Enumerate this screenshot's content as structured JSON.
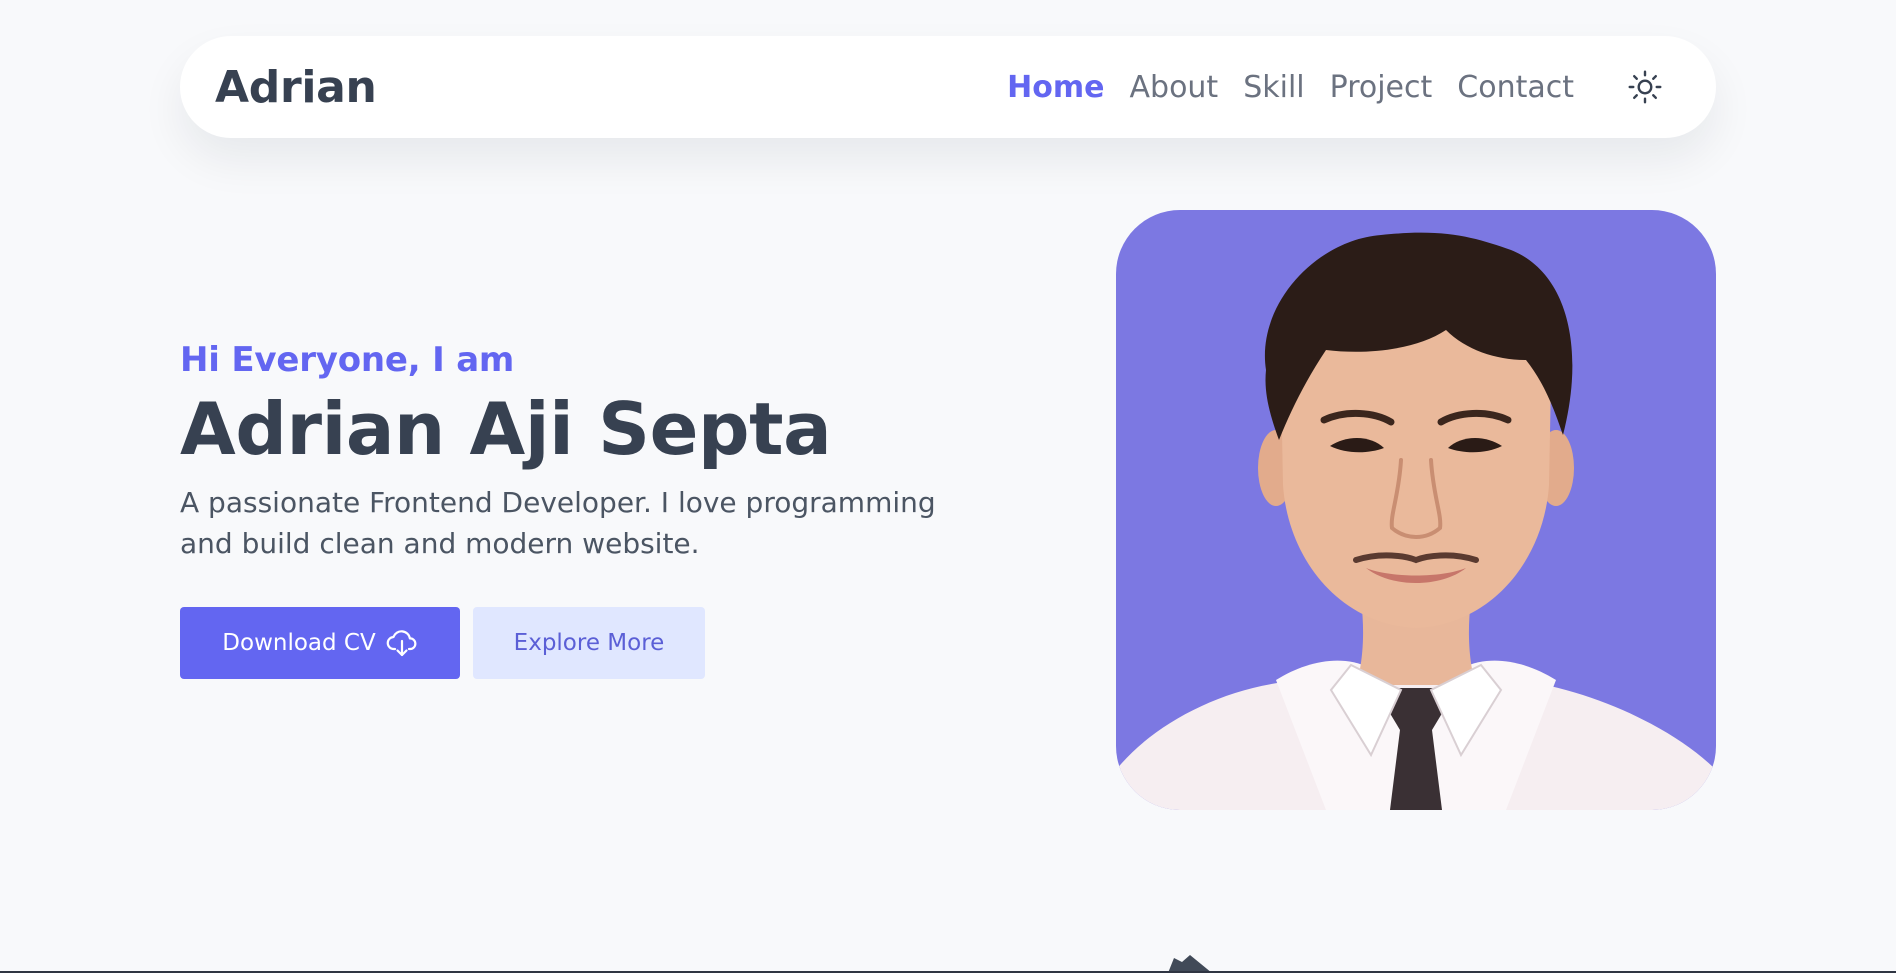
{
  "nav": {
    "brand": "Adrian",
    "links": [
      "Home",
      "About",
      "Skill",
      "Project",
      "Contact"
    ],
    "active": "Home",
    "theme_toggle_icon": "sun-icon"
  },
  "hero": {
    "greeting": "Hi Everyone, I am",
    "name": "Adrian Aji Septa",
    "tagline": "A passionate Frontend Developer. I love programming and build clean and modern website.",
    "primary_button": "Download CV",
    "primary_button_icon": "cloud-download-icon",
    "secondary_button": "Explore More"
  },
  "portrait": {
    "icon": "profile-photo",
    "background_color": "#7c78e2"
  },
  "colors": {
    "accent": "#6366f1",
    "accent_light": "#e0e7ff",
    "text_dark": "#374151",
    "text_muted": "#6b7280",
    "background": "#f8f9fb"
  }
}
